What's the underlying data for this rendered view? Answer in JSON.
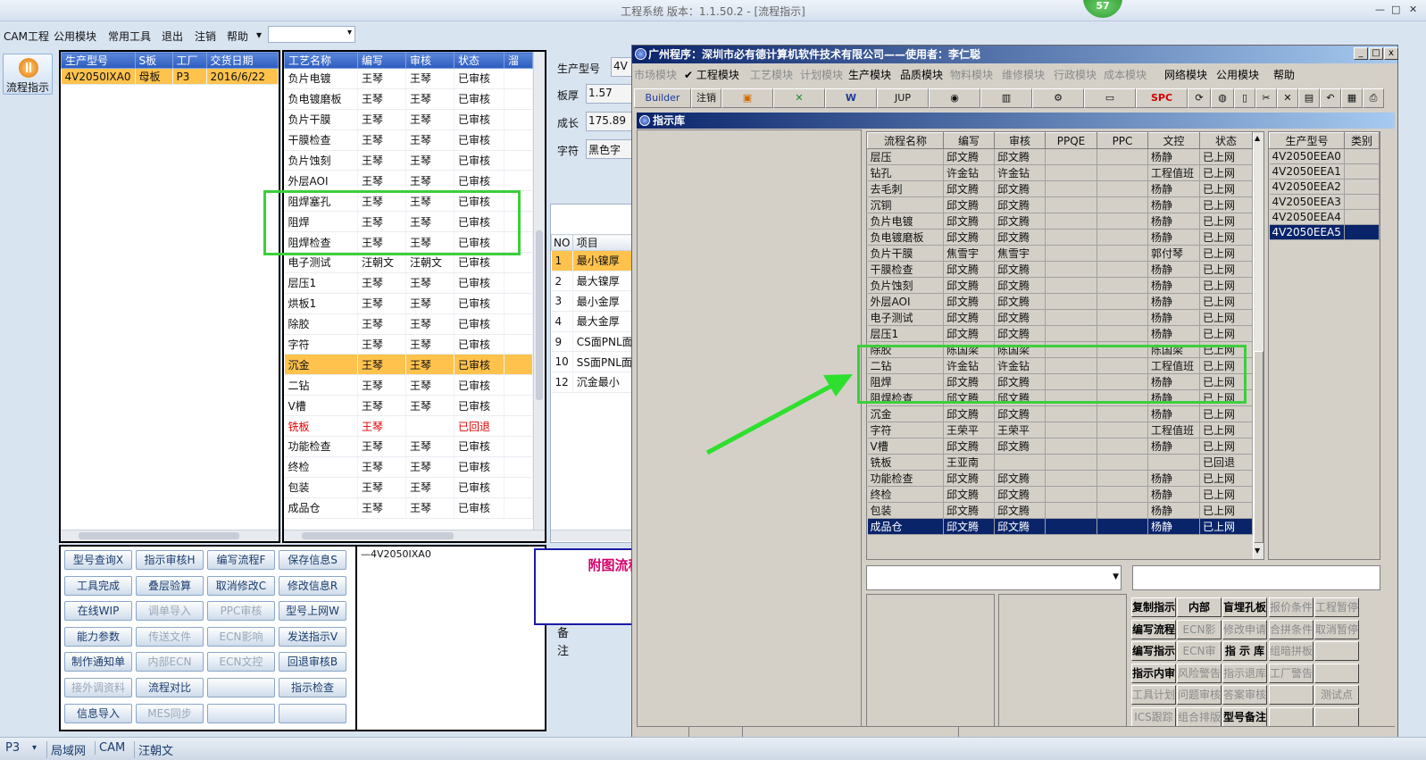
{
  "app": {
    "title": "工程系统   版本：1.1.50.2 - [流程指示]",
    "badge": "57",
    "win_min": "—",
    "win_max": "□",
    "win_close": "✕"
  },
  "menubar": [
    "CAM工程",
    "公用模块",
    "常用工具",
    "退出",
    "注销",
    "帮助",
    "▾"
  ],
  "left_icon": {
    "label": "流程指示"
  },
  "product_table": {
    "headers": [
      "生产型号",
      "S板",
      "工厂",
      "交货日期"
    ],
    "rows": [
      [
        "4V2050IXA0",
        "母板",
        "P3",
        "2016/6/22"
      ]
    ]
  },
  "process_table": {
    "headers": [
      "工艺名称",
      "编写",
      "审核",
      "状态",
      "溜"
    ],
    "rows": [
      [
        "负片电镀",
        "王琴",
        "王琴",
        "已审核"
      ],
      [
        "负电镀磨板",
        "王琴",
        "王琴",
        "已审核"
      ],
      [
        "负片干膜",
        "王琴",
        "王琴",
        "已审核"
      ],
      [
        "干膜检查",
        "王琴",
        "王琴",
        "已审核"
      ],
      [
        "负片蚀刻",
        "王琴",
        "王琴",
        "已审核"
      ],
      [
        "外层AOI",
        "王琴",
        "王琴",
        "已审核"
      ],
      [
        "阻焊塞孔",
        "王琴",
        "王琴",
        "已审核"
      ],
      [
        "阻焊",
        "王琴",
        "王琴",
        "已审核"
      ],
      [
        "阻焊检查",
        "王琴",
        "王琴",
        "已审核"
      ],
      [
        "电子测试",
        "汪朝文",
        "汪朝文",
        "已审核"
      ],
      [
        "层压1",
        "王琴",
        "王琴",
        "已审核"
      ],
      [
        "烘板1",
        "王琴",
        "王琴",
        "已审核"
      ],
      [
        "除胶",
        "王琴",
        "王琴",
        "已审核"
      ],
      [
        "字符",
        "王琴",
        "王琴",
        "已审核"
      ],
      [
        "沉金",
        "王琴",
        "王琴",
        "已审核"
      ],
      [
        "二钻",
        "王琴",
        "王琴",
        "已审核"
      ],
      [
        "V槽",
        "王琴",
        "王琴",
        "已审核"
      ],
      [
        "铣板",
        "王琴",
        "",
        "已回退"
      ],
      [
        "功能检查",
        "王琴",
        "王琴",
        "已审核"
      ],
      [
        "终检",
        "王琴",
        "王琴",
        "已审核"
      ],
      [
        "包装",
        "王琴",
        "王琴",
        "已审核"
      ],
      [
        "成品仓",
        "王琴",
        "王琴",
        "已审核"
      ]
    ]
  },
  "info_form": {
    "fields": [
      {
        "label": "生产型号",
        "value": "4V"
      },
      {
        "label": "板厚",
        "value": "1.57"
      },
      {
        "label": "成长",
        "value": "175.89"
      },
      {
        "label": "字符",
        "value": "黑色字"
      }
    ]
  },
  "items_table": {
    "headers": [
      "NO",
      "项目"
    ],
    "rows": [
      [
        "1",
        "最小镍厚"
      ],
      [
        "2",
        "最大镍厚"
      ],
      [
        "3",
        "最小金厚"
      ],
      [
        "4",
        "最大金厚"
      ],
      [
        "9",
        "CS面PNL面"
      ],
      [
        "10",
        "SS面PNL面"
      ],
      [
        "12",
        "沉金最小"
      ]
    ]
  },
  "button_grid": [
    [
      "型号查询X",
      "指示审核H",
      "编写流程F",
      "保存信息S"
    ],
    [
      "工具完成",
      "叠层验算",
      "取消修改C",
      "修改信息R"
    ],
    [
      "在线WIP",
      "调单导入",
      "PPC审核",
      "型号上网W"
    ],
    [
      "能力参数",
      "传送文件",
      "ECN影响",
      "发送指示V"
    ],
    [
      "制作通知单",
      "内部ECN",
      "ECN文控",
      "回退审核B"
    ],
    [
      "接外调资料",
      "流程对比",
      "",
      "指示检查"
    ],
    [
      "信息导入",
      "MES同步",
      "",
      ""
    ]
  ],
  "tree": {
    "node": "4V2050IXA0"
  },
  "remark": {
    "label1": "备",
    "label2": "注"
  },
  "note": {
    "text": "附图流程请按参考板子制作"
  },
  "win": {
    "title": "广州程序：深圳市必有德计算机软件技术有限公司——使用者：李仁聪",
    "menu": [
      "市场模块",
      "✔ 工程模块",
      "工艺模块",
      "计划模块",
      "生产模块",
      "品质模块",
      "物料模块",
      "维修模块",
      "行政模块",
      "成本模块",
      "网络模块",
      "公用模块",
      "帮助"
    ],
    "toolbar": [
      "Builder",
      "注销",
      "JUP",
      "SPC"
    ],
    "lib_title": "指示库",
    "flow_headers": [
      "流程名称",
      "编写",
      "审核",
      "PPQE",
      "PPC",
      "文控",
      "状态"
    ],
    "flow_rows": [
      [
        "层压",
        "邱文腾",
        "邱文腾",
        "",
        "",
        "杨静",
        "已上网"
      ],
      [
        "钻孔",
        "许金钻",
        "许金钻",
        "",
        "",
        "工程值班",
        "已上网"
      ],
      [
        "去毛刺",
        "邱文腾",
        "邱文腾",
        "",
        "",
        "杨静",
        "已上网"
      ],
      [
        "沉铜",
        "邱文腾",
        "邱文腾",
        "",
        "",
        "杨静",
        "已上网"
      ],
      [
        "负片电镀",
        "邱文腾",
        "邱文腾",
        "",
        "",
        "杨静",
        "已上网"
      ],
      [
        "负电镀磨板",
        "邱文腾",
        "邱文腾",
        "",
        "",
        "杨静",
        "已上网"
      ],
      [
        "负片干膜",
        "焦雪宇",
        "焦雪宇",
        "",
        "",
        "郭付琴",
        "已上网"
      ],
      [
        "干膜检查",
        "邱文腾",
        "邱文腾",
        "",
        "",
        "杨静",
        "已上网"
      ],
      [
        "负片蚀刻",
        "邱文腾",
        "邱文腾",
        "",
        "",
        "杨静",
        "已上网"
      ],
      [
        "外层AOI",
        "邱文腾",
        "邱文腾",
        "",
        "",
        "杨静",
        "已上网"
      ],
      [
        "电子测试",
        "邱文腾",
        "邱文腾",
        "",
        "",
        "杨静",
        "已上网"
      ],
      [
        "层压1",
        "邱文腾",
        "邱文腾",
        "",
        "",
        "杨静",
        "已上网"
      ],
      [
        "除胶",
        "陈国梁",
        "陈国梁",
        "",
        "",
        "陈国梁",
        "已上网"
      ],
      [
        "二钻",
        "许金钻",
        "许金钻",
        "",
        "",
        "工程值班",
        "已上网"
      ],
      [
        "阻焊",
        "邱文腾",
        "邱文腾",
        "",
        "",
        "杨静",
        "已上网"
      ],
      [
        "阻焊检查",
        "邱文腾",
        "邱文腾",
        "",
        "",
        "杨静",
        "已上网"
      ],
      [
        "沉金",
        "邱文腾",
        "邱文腾",
        "",
        "",
        "杨静",
        "已上网"
      ],
      [
        "字符",
        "王荣平",
        "王荣平",
        "",
        "",
        "工程值班",
        "已上网"
      ],
      [
        "V槽",
        "邱文腾",
        "邱文腾",
        "",
        "",
        "杨静",
        "已上网"
      ],
      [
        "铣板",
        "王亚南",
        "",
        "",
        "",
        "",
        "已回退"
      ],
      [
        "功能检查",
        "邱文腾",
        "邱文腾",
        "",
        "",
        "杨静",
        "已上网"
      ],
      [
        "终检",
        "邱文腾",
        "邱文腾",
        "",
        "",
        "杨静",
        "已上网"
      ],
      [
        "包装",
        "邱文腾",
        "邱文腾",
        "",
        "",
        "杨静",
        "已上网"
      ],
      [
        "成品仓",
        "邱文腾",
        "邱文腾",
        "",
        "",
        "杨静",
        "已上网"
      ]
    ],
    "model_headers": [
      "生产型号",
      "类别"
    ],
    "model_rows": [
      "4V2050EEA0",
      "4V2050EEA1",
      "4V2050EEA2",
      "4V2050EEA3",
      "4V2050EEA4",
      "4V2050EEA5"
    ],
    "buttons": [
      [
        "复制指示",
        "内部ECN",
        "盲埋孔板",
        "报价条件",
        "工程暂停"
      ],
      [
        "编写流程",
        "ECN影响",
        "修改申请",
        "合拼条件",
        "取消暂停"
      ],
      [
        "编写指示",
        "ECN审核",
        "指 示 库",
        "组暗拼板",
        ""
      ],
      [
        "指示内审",
        "风险警告",
        "指示退库",
        "工厂警告",
        ""
      ],
      [
        "工具计划",
        "问题审核",
        "答案审核",
        "",
        "测试点"
      ],
      [
        "ICS跟踪",
        "组合排版",
        "型号备注",
        "",
        ""
      ]
    ]
  },
  "statusbar": [
    "P3",
    "▾",
    "局域网",
    "CAM",
    "汪朝文"
  ]
}
